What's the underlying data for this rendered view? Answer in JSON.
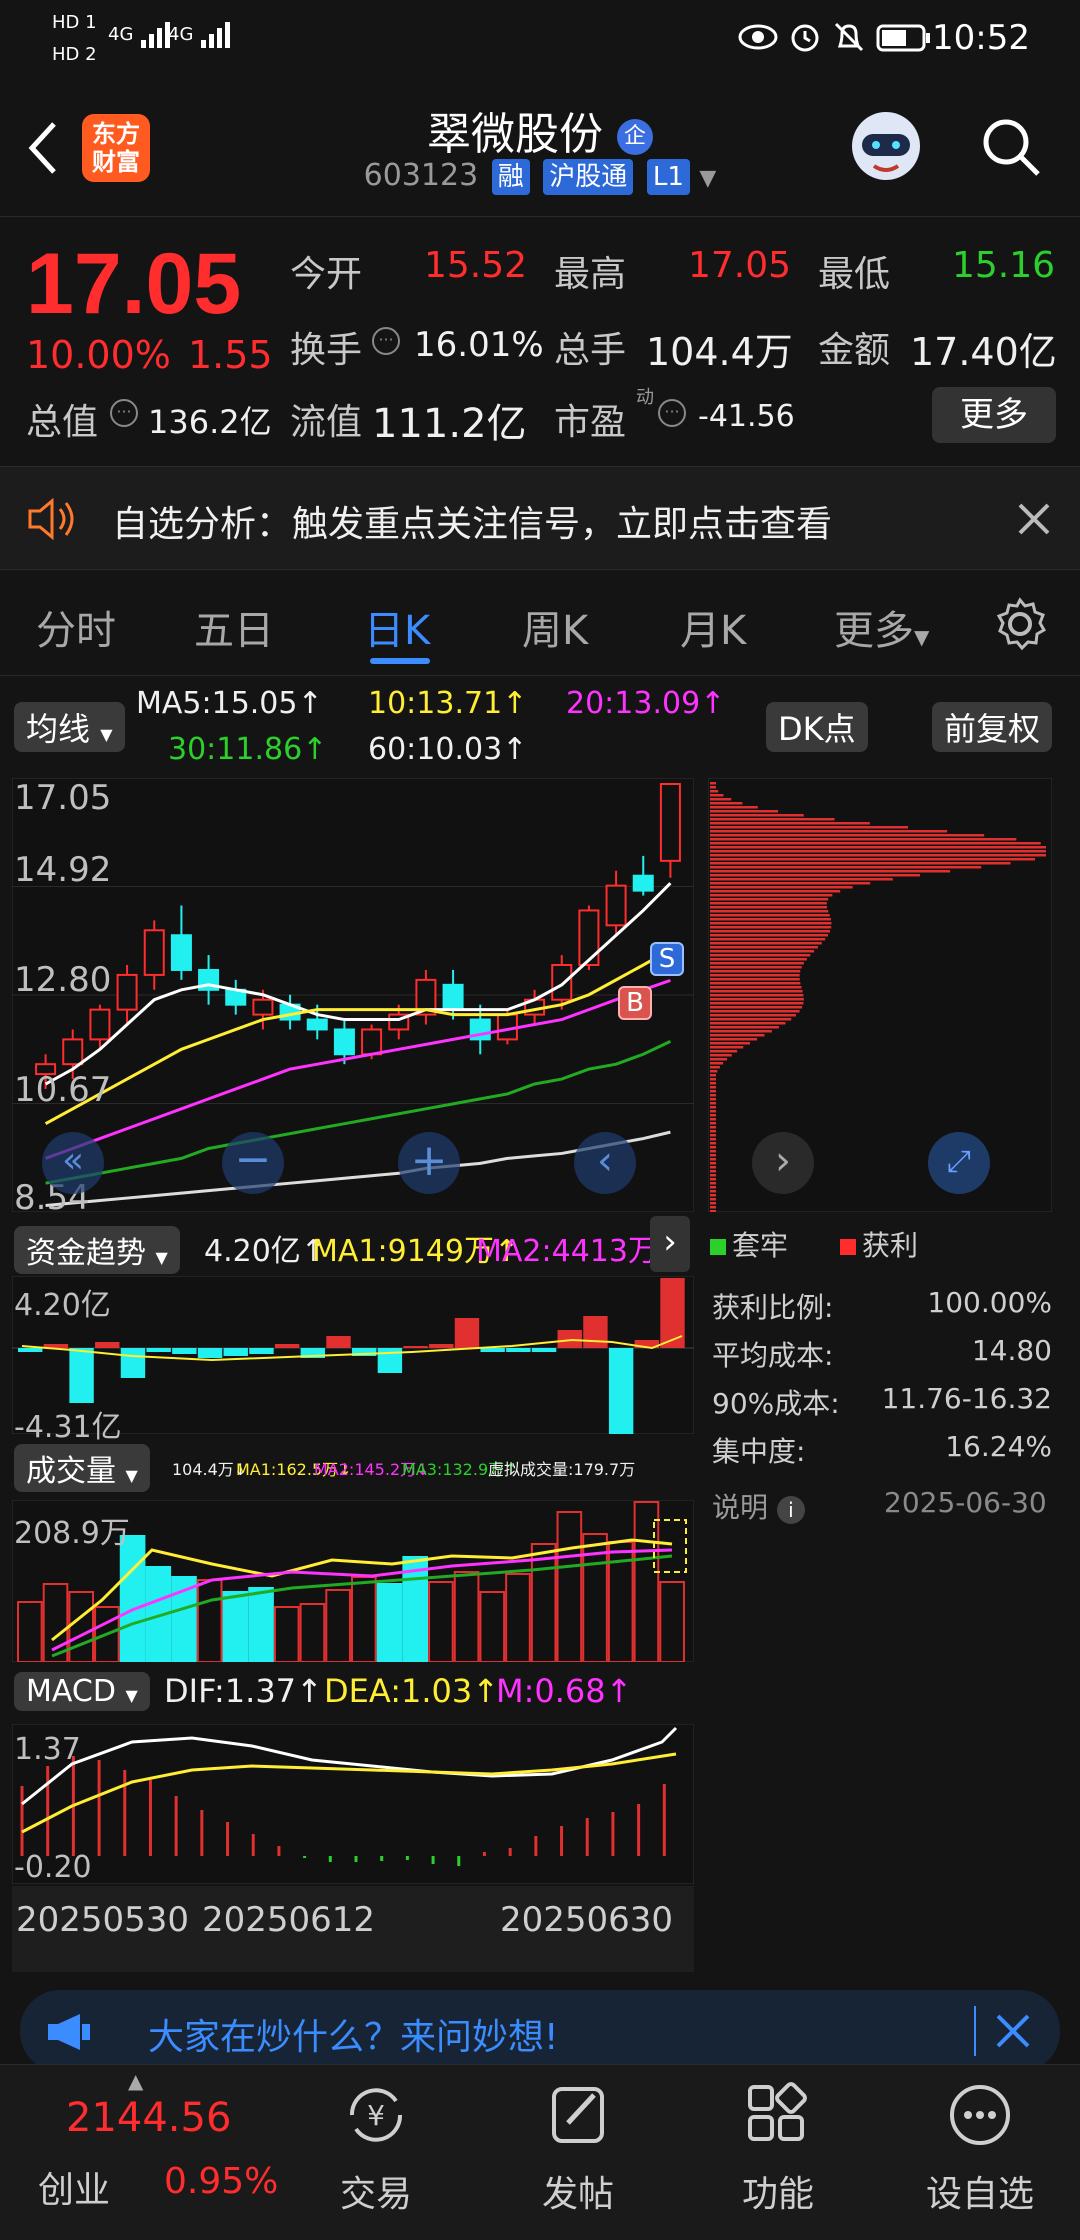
{
  "status": {
    "sim1": "HD 1",
    "sim2": "HD 2",
    "net1": "4G",
    "net2": "4G",
    "time": "10:52"
  },
  "header": {
    "logo_line1": "东方",
    "logo_line2": "财富",
    "name": "翠微股份",
    "name_badge": "企",
    "code": "603123",
    "tags": [
      "融",
      "沪股通",
      "L1"
    ]
  },
  "quote": {
    "price": "17.05",
    "change_pct": "10.00%",
    "change_amt": "1.55",
    "open_label": "今开",
    "open": "15.52",
    "high_label": "最高",
    "high": "17.05",
    "low_label": "最低",
    "low": "15.16",
    "turnover_label": "换手",
    "turnover": "16.01%",
    "vol_label": "总手",
    "vol": "104.4万",
    "amount_label": "金额",
    "amount": "17.40亿",
    "mcap_label": "总值",
    "mcap": "136.2亿",
    "float_label": "流值",
    "float": "111.2亿",
    "pe_label": "市盈",
    "pe_sup": "动",
    "pe": "-41.56",
    "more": "更多"
  },
  "notice": {
    "text": "自选分析：触发重点关注信号，立即点击查看"
  },
  "tabs": [
    "分时",
    "五日",
    "日K",
    "周K",
    "月K",
    "更多"
  ],
  "ma_bar": {
    "selector": "均线",
    "ma5": "MA5:15.05↑",
    "ma10": "10:13.71↑",
    "ma20": "20:13.09↑",
    "ma30": "30:11.86↑",
    "ma60": "60:10.03↑",
    "dk": "DK点",
    "fq": "前复权"
  },
  "kline": {
    "y_labels": [
      "17.05",
      "14.92",
      "12.80",
      "10.67",
      "8.54"
    ],
    "b_mark": "B",
    "s_mark": "S"
  },
  "capital": {
    "selector": "资金趋势",
    "val": "4.20亿↑",
    "ma1": "MA1:9149万↑",
    "ma2": "MA2:4413万↑",
    "top": "4.20亿",
    "bottom": "-4.31亿"
  },
  "volume": {
    "selector": "成交量",
    "line": "104.4万↓",
    "ma1": "MA1:162.5万↓",
    "ma2": "MA2:145.2万↓",
    "ma3": "MA3:132.9万↑",
    "virtual": "虚拟成交量:179.7万",
    "top": "208.9万"
  },
  "macd": {
    "selector": "MACD",
    "dif": "DIF:1.37↑",
    "dea": "DEA:1.03↑",
    "m": "M:0.68↑",
    "top": "1.37",
    "bottom": "-0.20"
  },
  "dates": [
    "20250530",
    "20250612",
    "20250630"
  ],
  "chip": {
    "legend_trap": "套牢",
    "legend_profit": "获利",
    "rows": [
      {
        "label": "获利比例:",
        "value": "100.00%"
      },
      {
        "label": "平均成本:",
        "value": "14.80"
      },
      {
        "label": "90%成本:",
        "value": "11.76-16.32"
      },
      {
        "label": "集中度:",
        "value": "16.24%"
      }
    ],
    "note_label": "说明",
    "date": "2025-06-30"
  },
  "ask_bar": {
    "text": "大家在炒什么？来问妙想!"
  },
  "nav": {
    "index_value": "2144.56",
    "index_name": "创业",
    "index_change": "0.95%",
    "items": [
      "交易",
      "发帖",
      "功能",
      "设自选"
    ]
  },
  "colors": {
    "up": "#ff2d2d",
    "down": "#22f0f0",
    "accent": "#3b8cff"
  },
  "chart_data": {
    "type": "candlestick",
    "ylim": [
      8.54,
      17.05
    ],
    "candles": [
      {
        "o": 11.2,
        "h": 11.6,
        "l": 10.9,
        "c": 11.4
      },
      {
        "o": 11.4,
        "h": 12.1,
        "l": 11.1,
        "c": 11.9
      },
      {
        "o": 11.9,
        "h": 12.6,
        "l": 11.7,
        "c": 12.5
      },
      {
        "o": 12.5,
        "h": 13.4,
        "l": 12.2,
        "c": 13.2
      },
      {
        "o": 13.2,
        "h": 14.3,
        "l": 12.9,
        "c": 14.1
      },
      {
        "o": 14.0,
        "h": 14.6,
        "l": 13.1,
        "c": 13.3
      },
      {
        "o": 13.3,
        "h": 13.6,
        "l": 12.6,
        "c": 12.9
      },
      {
        "o": 12.9,
        "h": 13.1,
        "l": 12.4,
        "c": 12.6
      },
      {
        "o": 12.4,
        "h": 12.9,
        "l": 12.1,
        "c": 12.7
      },
      {
        "o": 12.6,
        "h": 12.8,
        "l": 12.1,
        "c": 12.3
      },
      {
        "o": 12.3,
        "h": 12.6,
        "l": 11.9,
        "c": 12.1
      },
      {
        "o": 12.1,
        "h": 12.3,
        "l": 11.4,
        "c": 11.6
      },
      {
        "o": 11.6,
        "h": 12.2,
        "l": 11.5,
        "c": 12.1
      },
      {
        "o": 12.1,
        "h": 12.6,
        "l": 11.9,
        "c": 12.4
      },
      {
        "o": 12.4,
        "h": 13.3,
        "l": 12.2,
        "c": 13.1
      },
      {
        "o": 13.0,
        "h": 13.3,
        "l": 12.3,
        "c": 12.5
      },
      {
        "o": 12.3,
        "h": 12.6,
        "l": 11.6,
        "c": 11.9
      },
      {
        "o": 11.9,
        "h": 12.5,
        "l": 11.8,
        "c": 12.4
      },
      {
        "o": 12.4,
        "h": 12.9,
        "l": 12.2,
        "c": 12.7
      },
      {
        "o": 12.7,
        "h": 13.6,
        "l": 12.5,
        "c": 13.4
      },
      {
        "o": 13.4,
        "h": 14.6,
        "l": 13.3,
        "c": 14.5
      },
      {
        "o": 14.2,
        "h": 15.3,
        "l": 14.0,
        "c": 15.0
      },
      {
        "o": 15.2,
        "h": 15.6,
        "l": 14.8,
        "c": 14.9
      },
      {
        "o": 15.5,
        "h": 17.05,
        "l": 15.16,
        "c": 17.05
      }
    ],
    "ma5": [
      11.0,
      11.3,
      11.7,
      12.2,
      12.7,
      12.9,
      13.0,
      12.9,
      12.8,
      12.6,
      12.4,
      12.3,
      12.3,
      12.3,
      12.5,
      12.5,
      12.5,
      12.5,
      12.7,
      13.0,
      13.5,
      14.0,
      14.5,
      15.05
    ],
    "ma10": [
      10.2,
      10.5,
      10.8,
      11.1,
      11.4,
      11.7,
      11.9,
      12.1,
      12.3,
      12.4,
      12.5,
      12.5,
      12.5,
      12.5,
      12.5,
      12.4,
      12.4,
      12.4,
      12.5,
      12.6,
      12.8,
      13.1,
      13.4,
      13.71
    ],
    "ma20": [
      9.5,
      9.7,
      9.9,
      10.1,
      10.3,
      10.5,
      10.7,
      10.9,
      11.1,
      11.3,
      11.4,
      11.5,
      11.6,
      11.7,
      11.8,
      11.9,
      12.0,
      12.1,
      12.2,
      12.3,
      12.5,
      12.7,
      12.9,
      13.09
    ],
    "ma30": [
      9.0,
      9.1,
      9.2,
      9.3,
      9.4,
      9.5,
      9.7,
      9.8,
      9.9,
      10.0,
      10.1,
      10.2,
      10.3,
      10.4,
      10.5,
      10.6,
      10.7,
      10.8,
      11.0,
      11.1,
      11.3,
      11.4,
      11.6,
      11.86
    ],
    "ma60": [
      8.55,
      8.6,
      8.65,
      8.7,
      8.75,
      8.8,
      8.85,
      8.9,
      8.95,
      9.0,
      9.05,
      9.1,
      9.15,
      9.2,
      9.3,
      9.35,
      9.4,
      9.5,
      9.55,
      9.6,
      9.7,
      9.8,
      9.9,
      10.03
    ]
  }
}
